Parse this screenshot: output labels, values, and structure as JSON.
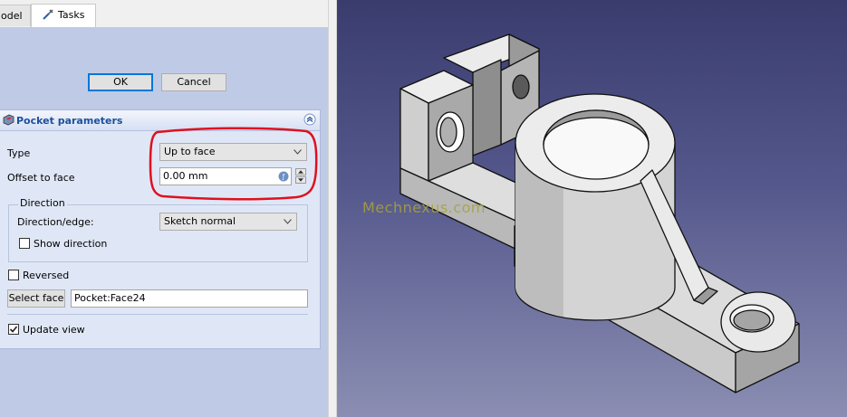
{
  "tabs": [
    {
      "label": "Model",
      "visible_label": "odel"
    },
    {
      "label": "Tasks"
    }
  ],
  "buttons": {
    "ok": "OK",
    "cancel": "Cancel"
  },
  "pocket": {
    "title": "Pocket parameters",
    "type_label": "Type",
    "type_value": "Up to face",
    "offset_label": "Offset to face",
    "offset_value": "0.00 mm",
    "direction_group": "Direction",
    "direction_edge_label": "Direction/edge:",
    "direction_edge_value": "Sketch normal",
    "show_direction": {
      "label": "Show direction",
      "checked": false
    },
    "reversed": {
      "label": "Reversed",
      "checked": false
    },
    "select_face_label": "Select face",
    "face_value": "Pocket:Face24",
    "update_view": {
      "label": "Update view",
      "checked": true
    }
  },
  "viewport": {
    "watermark": "Mechnexus.com"
  },
  "colors": {
    "task_bg": "#bfcbe6",
    "panel_bg": "#dfe7f6",
    "panel_title": "#1d4f9c",
    "highlight_ring": "#e0101e",
    "viewport_top": "#3a3c6e",
    "viewport_bottom": "#8b8eb2"
  },
  "icons": [
    "tasks-icon",
    "pocket-icon",
    "collapse-icon",
    "chevron-down-icon",
    "expression-icon",
    "spin-up-icon",
    "spin-down-icon",
    "checkmark-icon"
  ]
}
